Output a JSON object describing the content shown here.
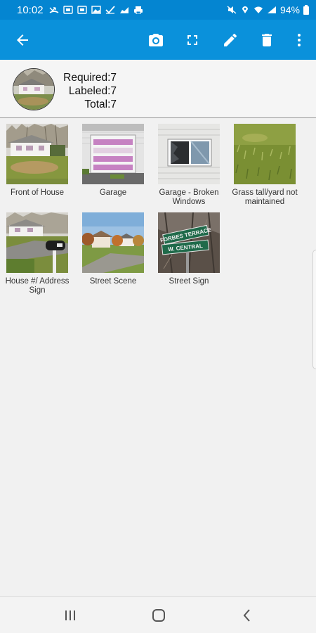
{
  "status_bar": {
    "time": "10:02",
    "battery": "94%",
    "icons": [
      "missed-call-icon",
      "photo-icon",
      "photo-icon",
      "image-icon",
      "check-icon",
      "chart-icon",
      "printer-icon"
    ]
  },
  "app_bar": {
    "actions": [
      "back-arrow-icon",
      "camera-icon",
      "fullscreen-icon",
      "edit-icon",
      "delete-icon",
      "more-vert-icon"
    ]
  },
  "summary": {
    "required": "Required:7",
    "labeled": "Labeled:7",
    "total": "Total:7"
  },
  "photos": [
    {
      "label": "Front of House"
    },
    {
      "label": "Garage"
    },
    {
      "label": "Garage - Broken Windows"
    },
    {
      "label": "Grass tall/yard not maintained"
    },
    {
      "label": "House #/ Address Sign"
    },
    {
      "label": "Street Scene"
    },
    {
      "label": "Street Sign"
    }
  ],
  "street_sign": {
    "line1": "FORBES TERRACE",
    "line2": "W. CENTRAL"
  },
  "colors": {
    "status_bar": "#0485d1",
    "app_bar": "#0a91db",
    "background": "#f1f1f1"
  }
}
